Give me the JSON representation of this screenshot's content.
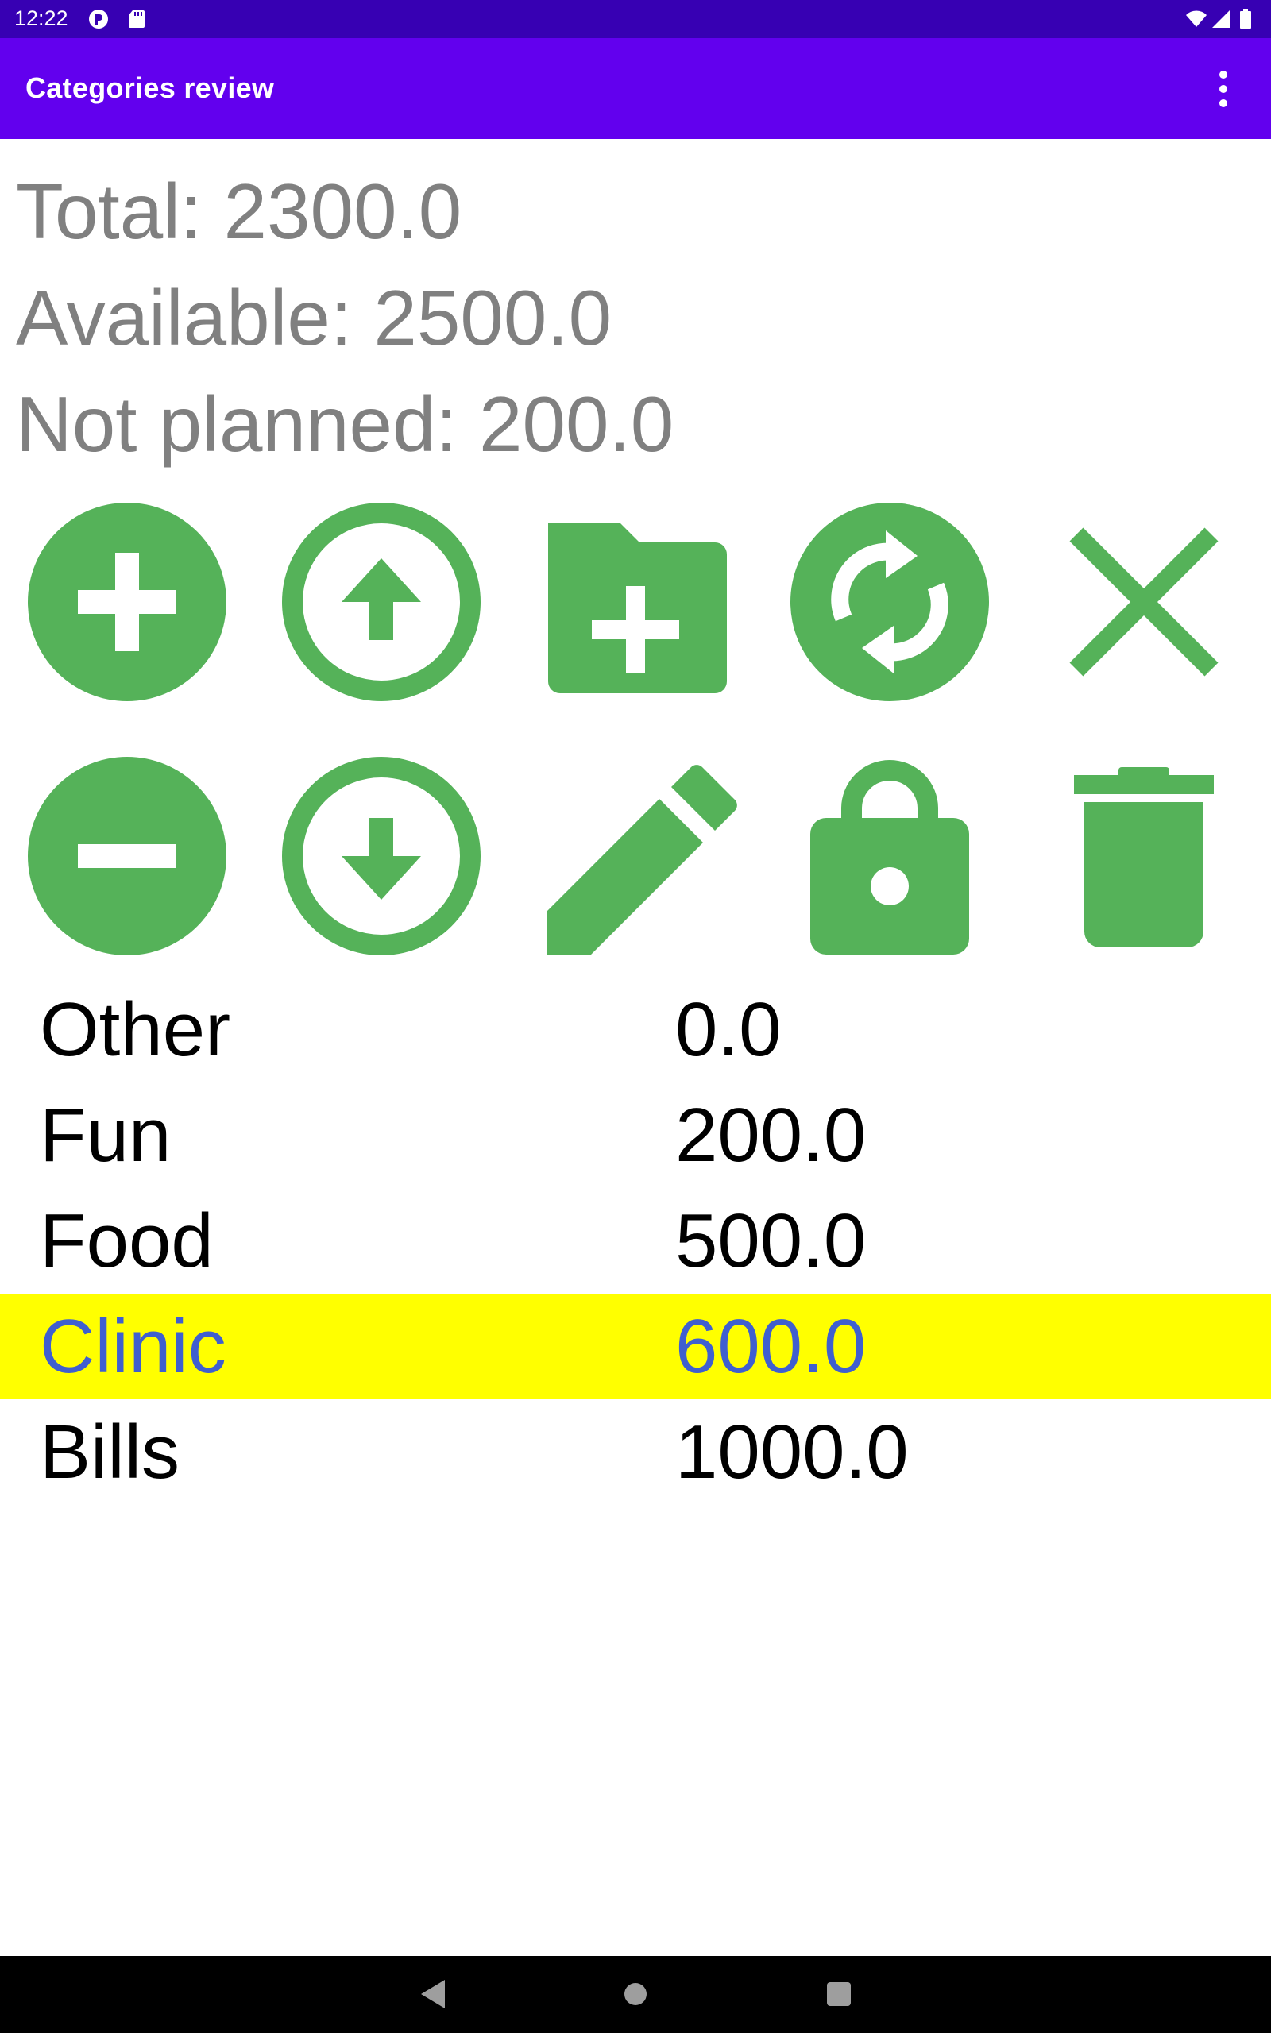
{
  "status_bar": {
    "time": "12:22",
    "icons": [
      "notification-p-icon",
      "sd-card-icon",
      "wifi-icon",
      "signal-icon",
      "battery-icon"
    ]
  },
  "app_bar": {
    "title": "Categories review",
    "menu_icon": "more-vert-icon"
  },
  "summary": {
    "total": "Total: 2300.0",
    "available": "Available: 2500.0",
    "not_planned": "Not planned: 200.0"
  },
  "actions": {
    "row1": [
      "add-circle-icon",
      "arrow-up-circle-icon",
      "folder-add-icon",
      "sync-icon",
      "close-icon"
    ],
    "row2": [
      "remove-circle-icon",
      "arrow-down-circle-icon",
      "edit-pencil-icon",
      "lock-icon",
      "delete-icon"
    ],
    "icon_color": "#55b259"
  },
  "categories": [
    {
      "name": "Other",
      "amount": "0.0",
      "selected": false
    },
    {
      "name": "Fun",
      "amount": "200.0",
      "selected": false
    },
    {
      "name": "Food",
      "amount": "500.0",
      "selected": false
    },
    {
      "name": "Clinic",
      "amount": "600.0",
      "selected": true
    },
    {
      "name": "Bills",
      "amount": "1000.0",
      "selected": false
    }
  ],
  "colors": {
    "status_bar": "#3700b3",
    "app_bar": "#6200ee",
    "selected_row": "#ffff00",
    "selected_text": "#3f5fcf",
    "summary_text": "#808080"
  },
  "nav_bar": {
    "icons": [
      "back-icon",
      "home-icon",
      "recents-icon"
    ]
  }
}
